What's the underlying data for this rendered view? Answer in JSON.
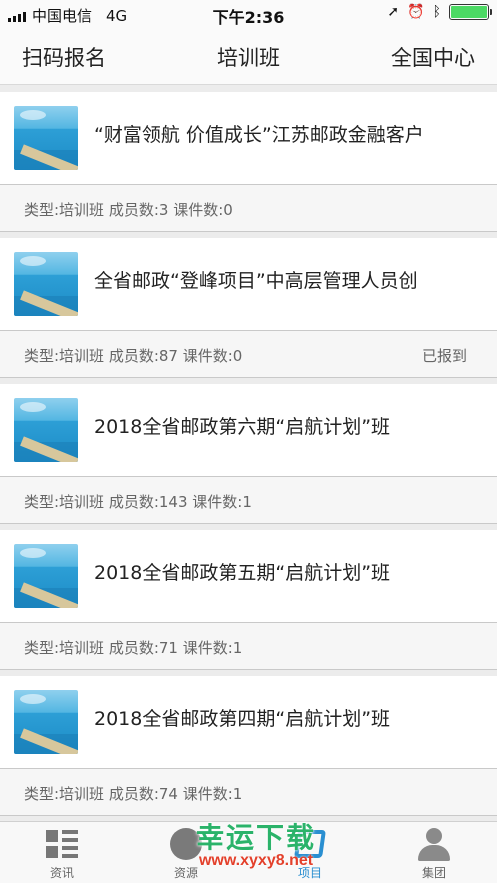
{
  "status_bar": {
    "carrier": "中国电信",
    "network": "4G",
    "time": "下午2:36",
    "icons": [
      "location-icon",
      "alarm-icon",
      "bluetooth-icon",
      "battery-icon"
    ],
    "battery_color": "#4cd964"
  },
  "nav": {
    "left": "扫码报名",
    "title": "培训班",
    "right": "全国中心"
  },
  "items": [
    {
      "title": "“财富领航 价值成长”江苏邮政金融客户",
      "meta": "类型:培训班 成员数:3 课件数:0",
      "status": ""
    },
    {
      "title": "全省邮政“登峰项目”中高层管理人员创",
      "meta": "类型:培训班 成员数:87 课件数:0",
      "status": "已报到"
    },
    {
      "title": "2018全省邮政第六期“启航计划”班",
      "meta": "类型:培训班 成员数:143 课件数:1",
      "status": ""
    },
    {
      "title": "2018全省邮政第五期“启航计划”班",
      "meta": "类型:培训班 成员数:71 课件数:1",
      "status": ""
    },
    {
      "title": "2018全省邮政第四期“启航计划”班",
      "meta": "类型:培训班 成员数:74 课件数:1",
      "status": ""
    }
  ],
  "tabs": [
    {
      "label": "资讯",
      "icon": "news-icon"
    },
    {
      "label": "资源",
      "icon": "resources-icon"
    },
    {
      "label": "项目",
      "icon": "project-icon",
      "active": true
    },
    {
      "label": "集团",
      "icon": "group-icon"
    }
  ],
  "watermark": {
    "title": "幸运下载",
    "url": "www.xyxy8.net"
  },
  "colors": {
    "accent": "#2a8fd1",
    "watermark_green": "#2bb36a",
    "watermark_red": "#e3402b"
  }
}
